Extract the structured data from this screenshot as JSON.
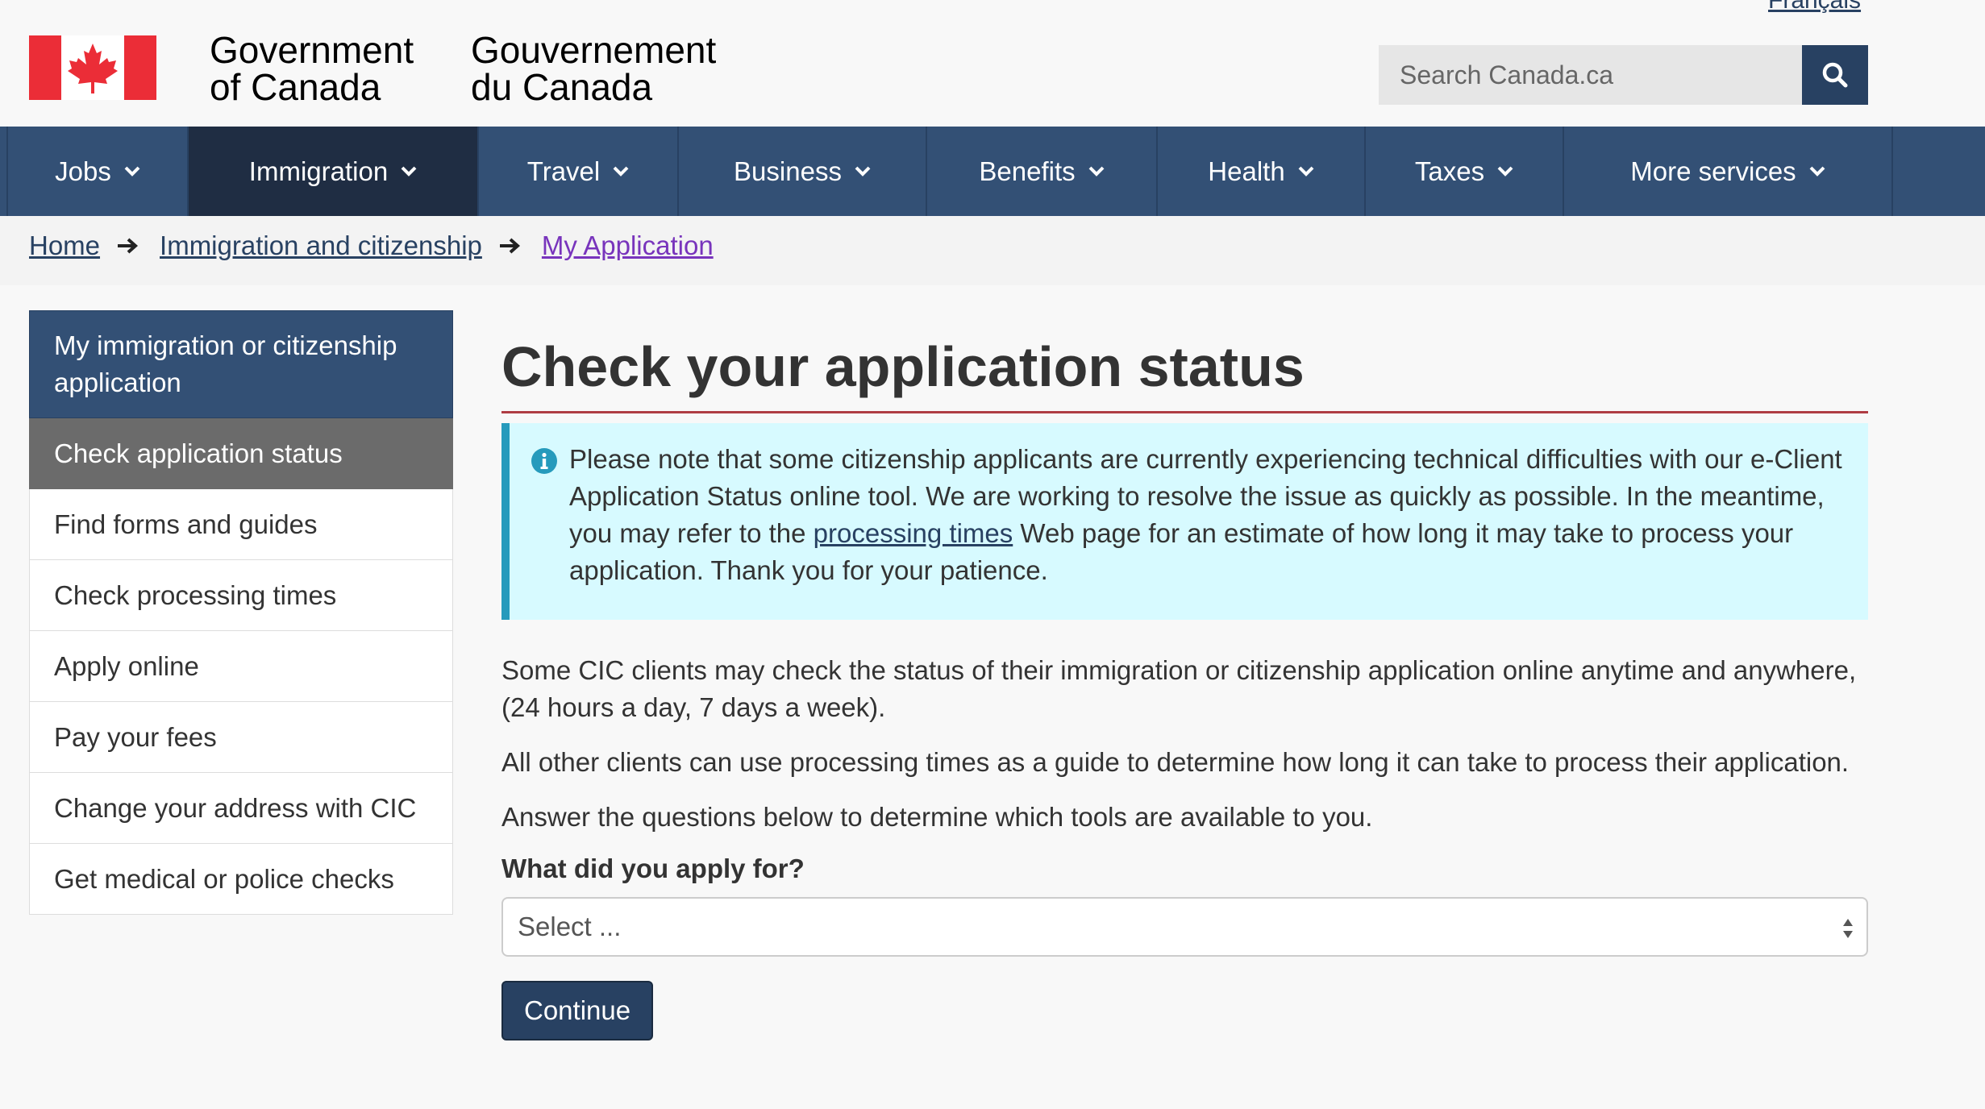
{
  "header": {
    "lang_toggle": "Français",
    "signature_en_line1": "Government",
    "signature_en_line2": "of Canada",
    "signature_fr_line1": "Gouvernement",
    "signature_fr_line2": "du Canada",
    "search_placeholder": "Search Canada.ca"
  },
  "menu": {
    "items": [
      {
        "label": "Jobs"
      },
      {
        "label": "Immigration"
      },
      {
        "label": "Travel"
      },
      {
        "label": "Business"
      },
      {
        "label": "Benefits"
      },
      {
        "label": "Health"
      },
      {
        "label": "Taxes"
      },
      {
        "label": "More services"
      }
    ],
    "active": "Immigration"
  },
  "breadcrumb": {
    "items": [
      "Home",
      "Immigration and citizenship",
      "My Application"
    ]
  },
  "sidenav": {
    "heading": "My immigration or citizenship application",
    "items": [
      "Check application status",
      "Find forms and guides",
      "Check processing times",
      "Apply online",
      "Pay your fees",
      "Change your address with CIC",
      "Get medical or police checks"
    ]
  },
  "main": {
    "title": "Check your application status",
    "alert": {
      "before_link": "Please note that some citizenship applicants are currently experiencing technical difficulties with our e-Client Application Status online tool. We are working to resolve the issue as quickly as possible. In the meantime, you may refer to the ",
      "link": "processing times",
      "after_link": " Web page for an estimate of how long it may take to process your application. Thank you for your patience."
    },
    "paragraph1": "Some CIC clients may check the status of their immigration or citizenship application online anytime and anywhere, (24 hours a day, 7 days a week).",
    "paragraph2": "All other clients can use processing times as a guide to determine how long it can take to process their application.",
    "paragraph3": "Answer the questions below to determine which tools are available to you.",
    "question_label": "What did you apply for?",
    "select_value": "Select ...",
    "continue_label": "Continue"
  },
  "colors": {
    "menu_bg": "#335075",
    "menu_active": "#1f2d43",
    "brand_dark": "#284162",
    "title_rule": "#af3c43",
    "alert_bg": "#d7faff",
    "alert_border": "#269abc",
    "flag_red": "#eb2d37"
  }
}
